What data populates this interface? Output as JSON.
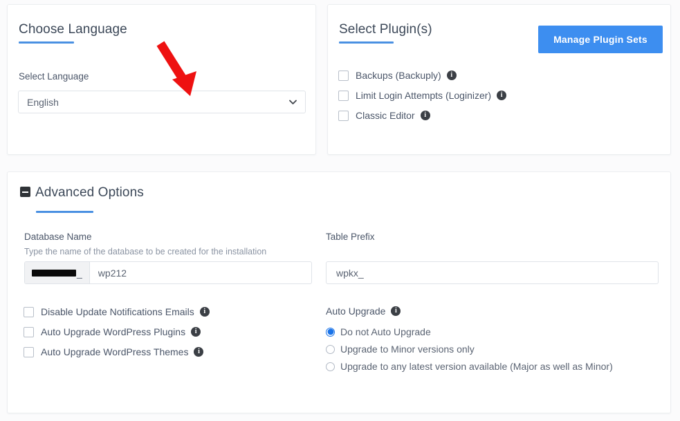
{
  "language_card": {
    "title": "Choose Language",
    "field_label": "Select Language",
    "selected_language": "English",
    "chevron_icon": "chevron-down-icon",
    "accent_color": "#4a90e2"
  },
  "plugins_card": {
    "title": "Select Plugin(s)",
    "manage_button_label": "Manage Plugin Sets",
    "manage_button_color": "#3d8ef0",
    "accent_color": "#4a90e2",
    "plugins": [
      {
        "label": "Backups (Backuply)",
        "checked": false,
        "info_icon": "info-icon"
      },
      {
        "label": "Limit Login Attempts (Loginizer)",
        "checked": false,
        "info_icon": "info-icon"
      },
      {
        "label": "Classic Editor",
        "checked": false,
        "info_icon": "info-icon"
      }
    ]
  },
  "advanced_card": {
    "title": "Advanced Options",
    "toggle_icon": "minus-square-icon",
    "accent_color": "#4a90e2",
    "database": {
      "label": "Database Name",
      "help_text": "Type the name of the database to be created for the installation",
      "prefix_redacted": true,
      "prefix_suffix": "_",
      "value": "wp212"
    },
    "table_prefix": {
      "label": "Table Prefix",
      "value": "wpkx_"
    },
    "options": [
      {
        "label": "Disable Update Notifications Emails",
        "checked": false,
        "info_icon": "info-icon"
      },
      {
        "label": "Auto Upgrade WordPress Plugins",
        "checked": false,
        "info_icon": "info-icon"
      },
      {
        "label": "Auto Upgrade WordPress Themes",
        "checked": false,
        "info_icon": "info-icon"
      }
    ],
    "auto_upgrade": {
      "label": "Auto Upgrade",
      "info_icon": "info-icon",
      "selected_index": 0,
      "options": [
        "Do not Auto Upgrade",
        "Upgrade to Minor versions only",
        "Upgrade to any latest version available (Major as well as Minor)"
      ]
    }
  },
  "annotation": {
    "arrow_icon": "red-down-arrow-annotation",
    "color": "#ee1111"
  }
}
